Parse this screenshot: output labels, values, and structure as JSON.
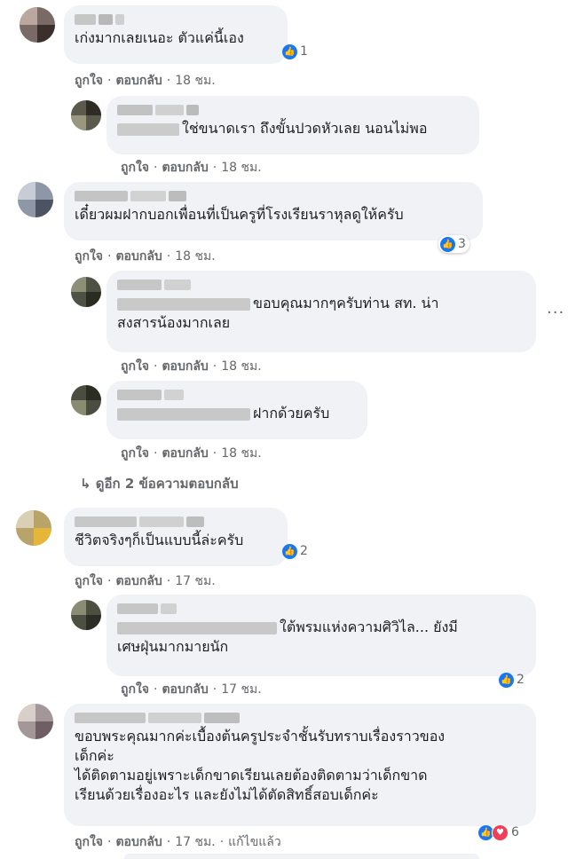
{
  "actions": {
    "like": "ถูกใจ",
    "reply": "ตอบกลับ",
    "separator": "·",
    "edited": "แก้ไขแล้ว"
  },
  "comments": [
    {
      "text": "เก่งมากเลยเนอะ ตัวแค่นี้เอง",
      "time": "18 ชม.",
      "reactions": "1"
    },
    {
      "text": "ใช่ขนาดเรา ถึงขั้นปวดหัวเลย นอนไม่พอ",
      "time": "18 ชม."
    },
    {
      "text": "เดี๋ยวผมฝากบอกเพื่อนที่เป็นครูที่โรงเรียนราหุลดูให้ครับ",
      "time": "18 ชม.",
      "reactions": "3"
    },
    {
      "text_line1": "ขอบคุณมากๆครับท่าน สท. น่า",
      "text_line2": "สงสารน้องมากเลย",
      "time": "18 ชม."
    },
    {
      "text": "ฝากด้วยครับ",
      "time": "18 ชม."
    },
    {
      "text": "ชีวิตจริงๆก็เป็นแบบนี้ล่ะครับ",
      "time": "17 ชม.",
      "reactions": "2"
    },
    {
      "text_line1": "ใต้พรมแห่งความศิวิไล... ยังมี",
      "text_line2": "เศษฝุ่นมากมายนัก",
      "time": "17 ชม.",
      "reactions": "2"
    },
    {
      "text_line1": "ขอบพระคุณมากค่ะเบื้องต้นครูประจำชั้นรับทราบเรื่องราวของ",
      "text_line2": "เด็กค่ะ",
      "text_line3": "ได้ติดตามอยู่เพราะเด็กขาดเรียนเลยต้องติดตามว่าเด็กขาด",
      "text_line4": "เรียนด้วยเรื่องอะไร และยังไม่ได้ตัดสิทธิ์สอบเด็กค่ะ",
      "time": "17 ชม.",
      "reactions": "6"
    }
  ],
  "more_replies": "↳ ดูอีก 2 ข้อความตอบกลับ",
  "more_options": "···",
  "colors": {
    "bubble": "#f0f2f5",
    "meta": "#65676b",
    "like": "#1877f2",
    "love": "#f33e58"
  },
  "icons": {
    "like": "like-icon",
    "love": "love-icon",
    "reply_arrow": "reply-arrow-icon",
    "options": "more-options-icon"
  }
}
